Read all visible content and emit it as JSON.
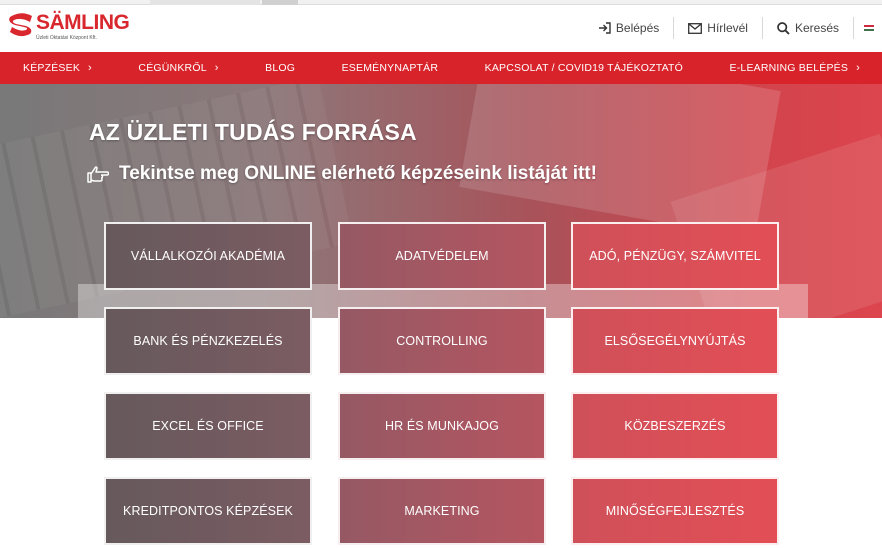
{
  "brand": {
    "name": "SÄMLING",
    "tagline": "Üzleti Oktatási Központ Kft.",
    "color": "#d9272e"
  },
  "header_nav": {
    "login_label": "Belépés",
    "newsletter_label": "Hírlevél",
    "search_label": "Keresés",
    "language_flag": "hungarian-flag"
  },
  "main_nav": {
    "items": [
      {
        "label": "KÉPZÉSEK",
        "has_chevron": true
      },
      {
        "label": "CÉGÜNKRŐL",
        "has_chevron": true
      },
      {
        "label": "BLOG",
        "has_chevron": false
      },
      {
        "label": "ESEMÉNYNAPTÁR",
        "has_chevron": false
      },
      {
        "label": "KAPCSOLAT / COVID19 TÁJÉKOZTATÓ",
        "has_chevron": false
      },
      {
        "label": "E-LEARNING BELÉPÉS",
        "has_chevron": true
      }
    ],
    "chevron": "›",
    "color": "#d8232a"
  },
  "hero": {
    "title": "AZ ÜZLETI TUDÁS FORRÁSA",
    "subtitle": "Tekintse meg ONLINE elérhető képzéseink listáját itt!",
    "subtitle_icon": "pointing-hand-icon"
  },
  "categories": [
    [
      "VÁLLALKOZÓI AKADÉMIA",
      "ADATVÉDELEM",
      "ADÓ, PÉNZÜGY, SZÁMVITEL"
    ],
    [
      "BANK ÉS PÉNZKEZELÉS",
      "CONTROLLING",
      "ELSŐSEGÉLYNYÚJTÁS"
    ],
    [
      "EXCEL ÉS OFFICE",
      "HR ÉS MUNKAJOG",
      "KÖZBESZERZÉS"
    ],
    [
      "KREDITPONTOS KÉPZÉSEK",
      "MARKETING",
      "MINŐSÉGFEJLESZTÉS"
    ]
  ]
}
